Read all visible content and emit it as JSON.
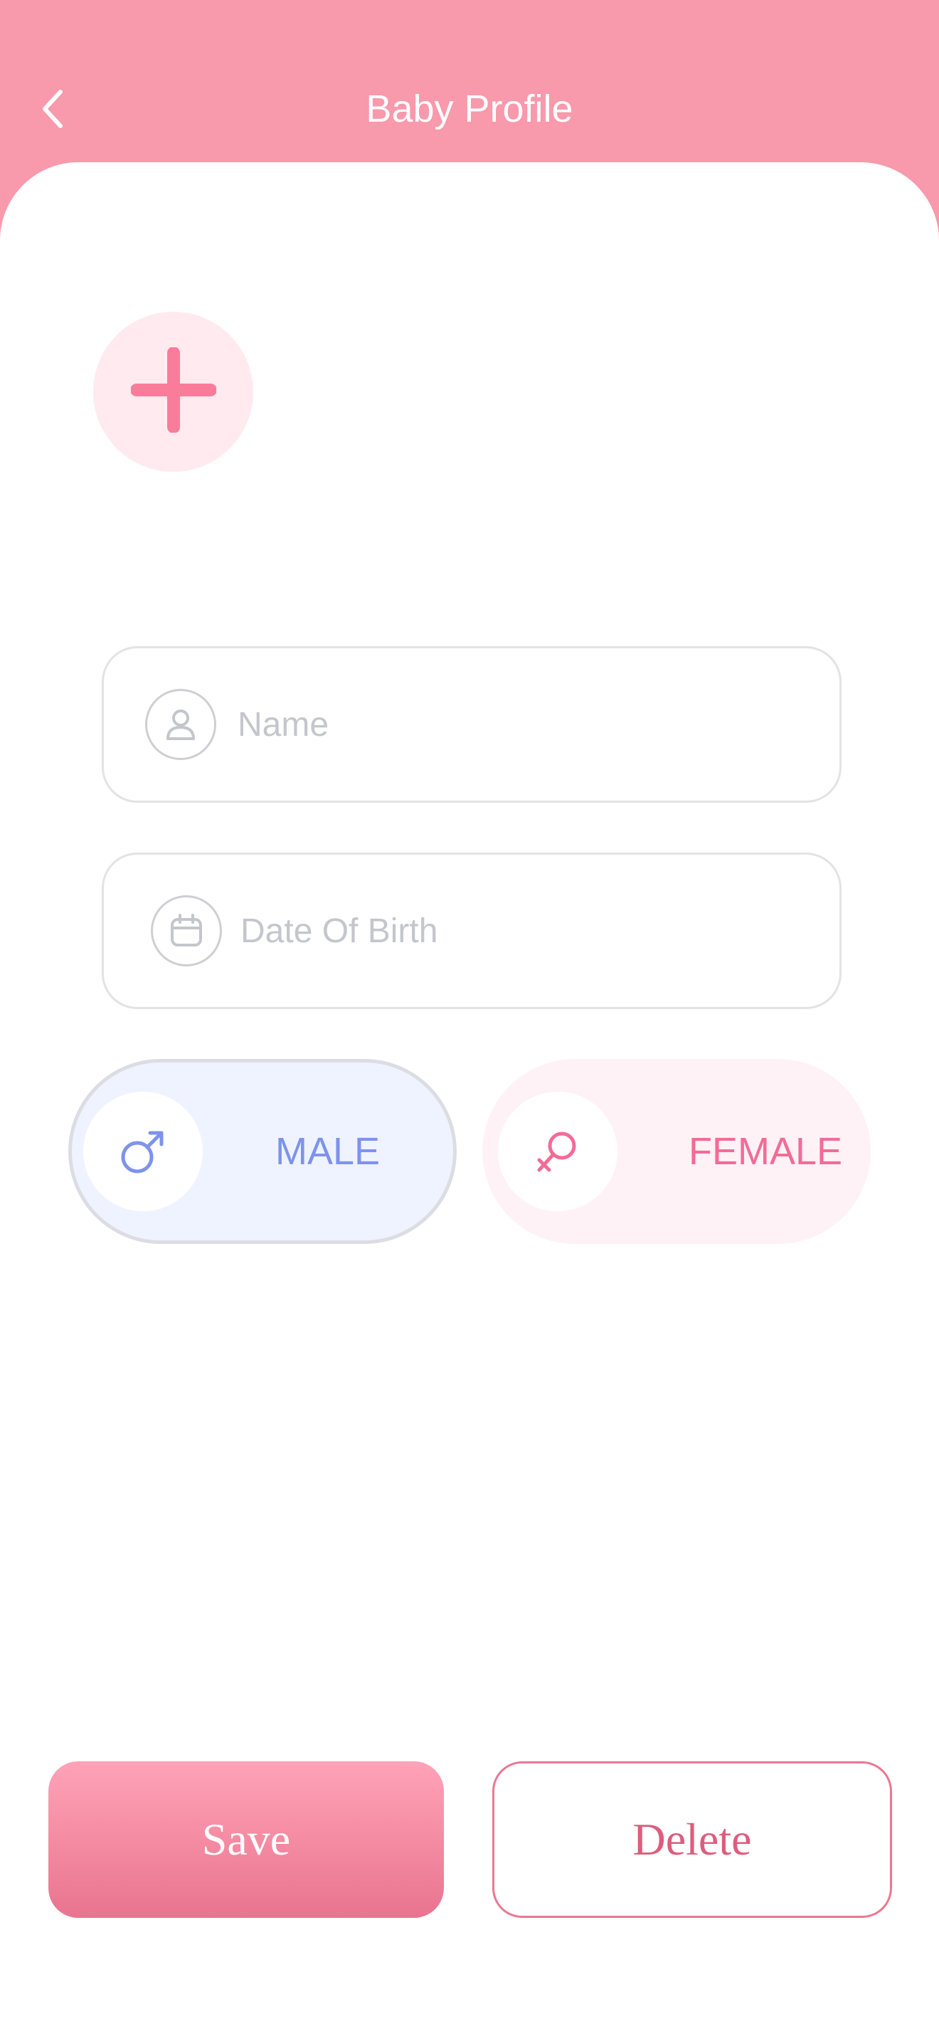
{
  "header": {
    "title": "Baby Profile",
    "back_icon": "chevron-left-icon",
    "background_color": "#f899ac"
  },
  "avatar": {
    "icon": "plus-icon",
    "circle_color": "#ffeaef",
    "icon_color": "#fa7c9b"
  },
  "form": {
    "name": {
      "placeholder": "Name",
      "value": "",
      "icon": "person-icon"
    },
    "dob": {
      "placeholder": "Date Of Birth",
      "value": "",
      "icon": "calendar-icon"
    }
  },
  "gender": {
    "male": {
      "label": "MALE",
      "icon": "male-symbol-icon",
      "color": "#7d93ec",
      "selected": true
    },
    "female": {
      "label": "FEMALE",
      "icon": "female-symbol-icon",
      "color": "#f36b97",
      "selected": false
    }
  },
  "actions": {
    "save_label": "Save",
    "delete_label": "Delete",
    "accent_color": "#ea7893"
  }
}
